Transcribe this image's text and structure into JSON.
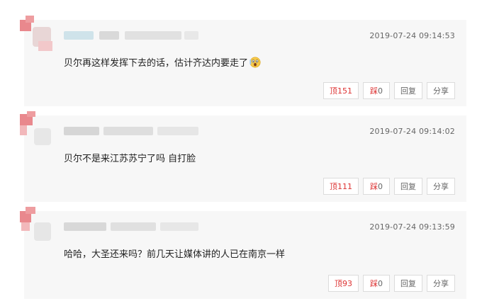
{
  "colors": {
    "accent": "#d33333",
    "card": "#f7f7f7",
    "text": "#222222",
    "meta": "#666666"
  },
  "comments": [
    {
      "time": "2019-07-24 09:14:53",
      "text": "贝尔再这样发挥下去的话，估计齐达内要走了",
      "emoji": "shocked-face-emoji",
      "up_icon": "顶",
      "up_count": "151",
      "down_icon": "踩",
      "down_count": "0",
      "reply": "回复",
      "share": "分享"
    },
    {
      "time": "2019-07-24 09:14:02",
      "text": "贝尔不是来江苏苏宁了吗 自打脸",
      "up_icon": "顶",
      "up_count": "111",
      "down_icon": "踩",
      "down_count": "0",
      "reply": "回复",
      "share": "分享"
    },
    {
      "time": "2019-07-24 09:13:59",
      "text": "哈哈，大圣还来吗？前几天让媒体讲的人已在南京一样",
      "up_icon": "顶",
      "up_count": "93",
      "down_icon": "踩",
      "down_count": "0",
      "reply": "回复",
      "share": "分享"
    }
  ]
}
